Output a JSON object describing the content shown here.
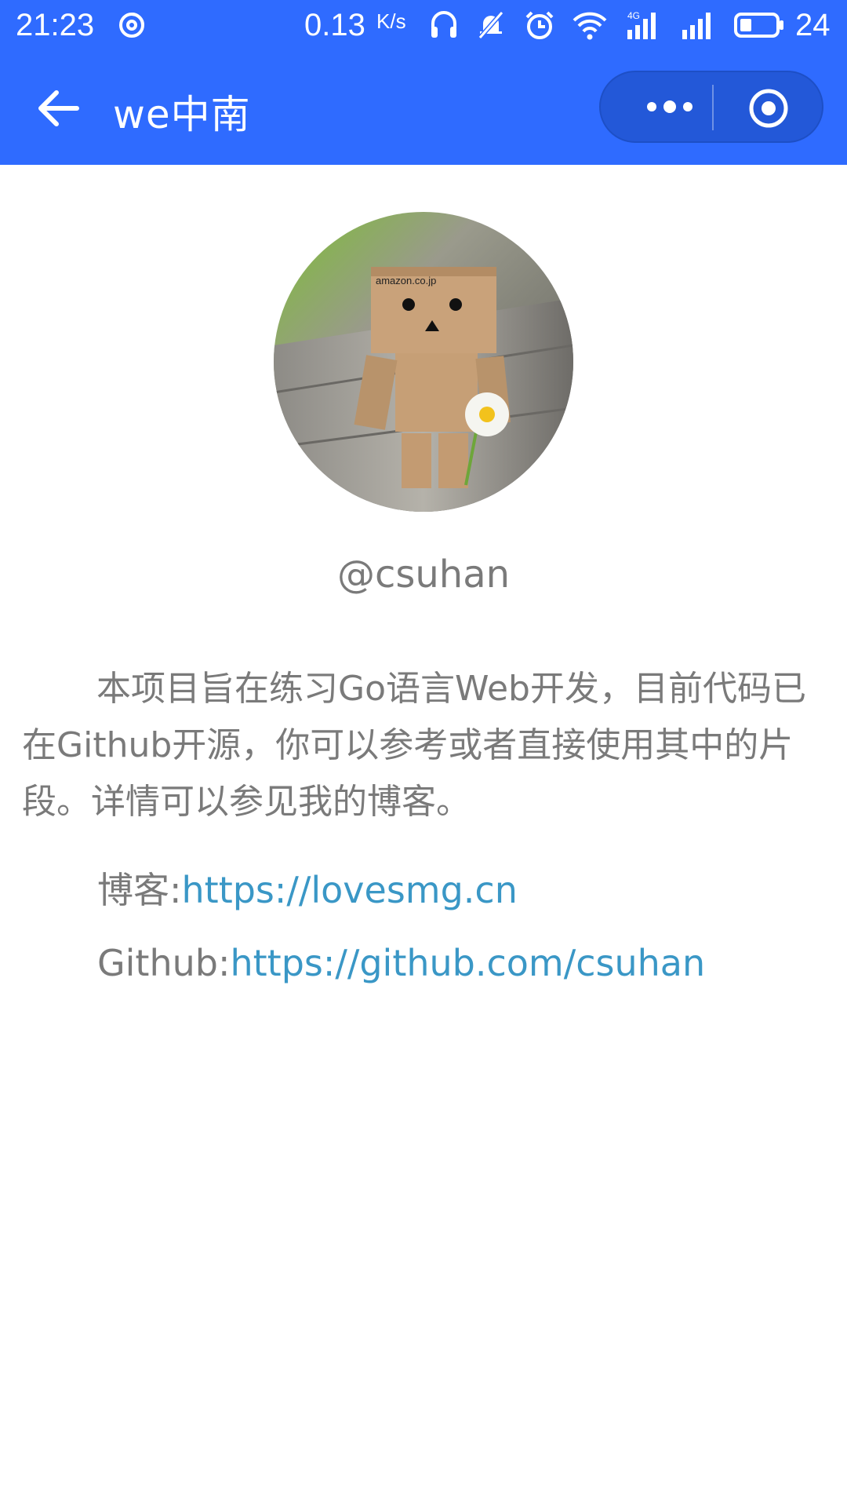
{
  "status_bar": {
    "time": "21:23",
    "network_speed": "0.13",
    "speed_unit": "K/s",
    "signal_type": "4G",
    "battery_level": "24"
  },
  "nav": {
    "title": "we中南"
  },
  "profile": {
    "handle": "@csuhan",
    "description": "本项目旨在练习Go语言Web开发，目前代码已在Github开源，你可以参考或者直接使用其中的片段。详情可以参见我的博客。",
    "blog_label": "博客:",
    "blog_url": "https://lovesmg.cn",
    "github_label": "Github:",
    "github_url": "https://github.com/csuhan",
    "avatar_brand_text": "amazon.co.jp"
  },
  "colors": {
    "header": "#2f6bff",
    "text": "#7a7a7a",
    "link": "#3a97c6"
  }
}
